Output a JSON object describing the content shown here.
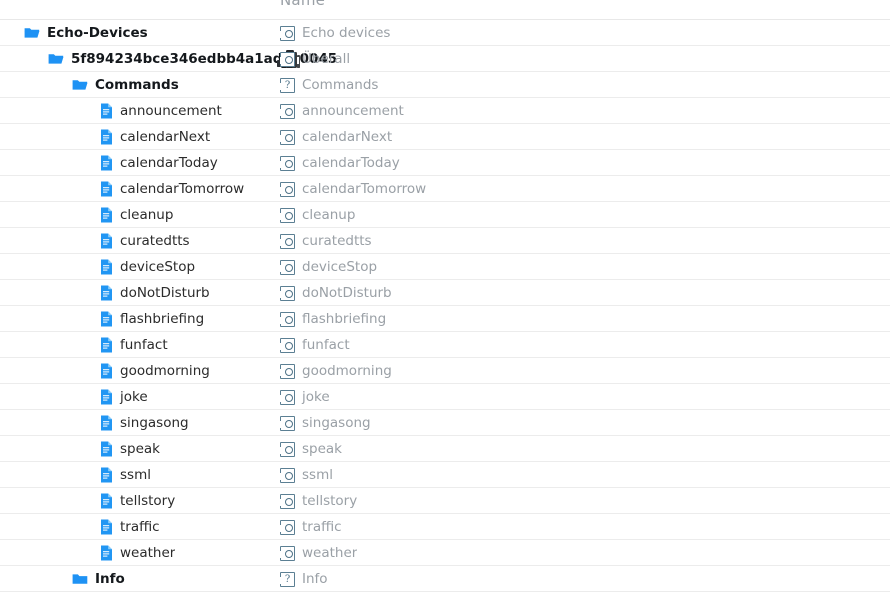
{
  "header": {
    "name_column_label": "Name"
  },
  "colors": {
    "folder_icon": "#1e92f4",
    "file_icon": "#2196f3",
    "row_border": "#ececec",
    "right_text": "#9aa0a6",
    "left_text": "#1a1a1a",
    "placeholder_stroke": "#5b7f93",
    "background": "#ffffff"
  },
  "tree": {
    "rows": [
      {
        "label": "Echo-Devices",
        "name": "Echo devices",
        "type": "folder",
        "icon": "folder-open-icon",
        "right_icon": "broken-image-icon",
        "indent": 0,
        "thumb": false
      },
      {
        "label": "5f894234bce346edbb4a1adce0045",
        "name": "Überall",
        "type": "folder",
        "icon": "folder-open-icon",
        "right_icon": "echo-device-thumbnail",
        "indent": 1,
        "thumb": true
      },
      {
        "label": "Commands",
        "name": "Commands",
        "type": "folder",
        "icon": "folder-open-icon",
        "right_icon": "broken-image-question-icon",
        "indent": 2,
        "thumb": false
      },
      {
        "label": "announcement",
        "name": "announcement",
        "type": "file",
        "icon": "file-icon",
        "right_icon": "broken-image-icon",
        "indent": 3,
        "thumb": false
      },
      {
        "label": "calendarNext",
        "name": "calendarNext",
        "type": "file",
        "icon": "file-icon",
        "right_icon": "broken-image-icon",
        "indent": 3,
        "thumb": false
      },
      {
        "label": "calendarToday",
        "name": "calendarToday",
        "type": "file",
        "icon": "file-icon",
        "right_icon": "broken-image-icon",
        "indent": 3,
        "thumb": false
      },
      {
        "label": "calendarTomorrow",
        "name": "calendarTomorrow",
        "type": "file",
        "icon": "file-icon",
        "right_icon": "broken-image-icon",
        "indent": 3,
        "thumb": false
      },
      {
        "label": "cleanup",
        "name": "cleanup",
        "type": "file",
        "icon": "file-icon",
        "right_icon": "broken-image-icon",
        "indent": 3,
        "thumb": false
      },
      {
        "label": "curatedtts",
        "name": "curatedtts",
        "type": "file",
        "icon": "file-icon",
        "right_icon": "broken-image-icon",
        "indent": 3,
        "thumb": false
      },
      {
        "label": "deviceStop",
        "name": "deviceStop",
        "type": "file",
        "icon": "file-icon",
        "right_icon": "broken-image-icon",
        "indent": 3,
        "thumb": false
      },
      {
        "label": "doNotDisturb",
        "name": "doNotDisturb",
        "type": "file",
        "icon": "file-icon",
        "right_icon": "broken-image-icon",
        "indent": 3,
        "thumb": false
      },
      {
        "label": "flashbriefing",
        "name": "flashbriefing",
        "type": "file",
        "icon": "file-icon",
        "right_icon": "broken-image-icon",
        "indent": 3,
        "thumb": false
      },
      {
        "label": "funfact",
        "name": "funfact",
        "type": "file",
        "icon": "file-icon",
        "right_icon": "broken-image-icon",
        "indent": 3,
        "thumb": false
      },
      {
        "label": "goodmorning",
        "name": "goodmorning",
        "type": "file",
        "icon": "file-icon",
        "right_icon": "broken-image-icon",
        "indent": 3,
        "thumb": false
      },
      {
        "label": "joke",
        "name": "joke",
        "type": "file",
        "icon": "file-icon",
        "right_icon": "broken-image-icon",
        "indent": 3,
        "thumb": false
      },
      {
        "label": "singasong",
        "name": "singasong",
        "type": "file",
        "icon": "file-icon",
        "right_icon": "broken-image-icon",
        "indent": 3,
        "thumb": false
      },
      {
        "label": "speak",
        "name": "speak",
        "type": "file",
        "icon": "file-icon",
        "right_icon": "broken-image-icon",
        "indent": 3,
        "thumb": false
      },
      {
        "label": "ssml",
        "name": "ssml",
        "type": "file",
        "icon": "file-icon",
        "right_icon": "broken-image-icon",
        "indent": 3,
        "thumb": false
      },
      {
        "label": "tellstory",
        "name": "tellstory",
        "type": "file",
        "icon": "file-icon",
        "right_icon": "broken-image-icon",
        "indent": 3,
        "thumb": false
      },
      {
        "label": "traffic",
        "name": "traffic",
        "type": "file",
        "icon": "file-icon",
        "right_icon": "broken-image-icon",
        "indent": 3,
        "thumb": false
      },
      {
        "label": "weather",
        "name": "weather",
        "type": "file",
        "icon": "file-icon",
        "right_icon": "broken-image-icon",
        "indent": 3,
        "thumb": false
      },
      {
        "label": "Info",
        "name": "Info",
        "type": "folder",
        "icon": "folder-closed-icon",
        "right_icon": "broken-image-question-icon",
        "indent": 2,
        "thumb": false
      }
    ]
  }
}
